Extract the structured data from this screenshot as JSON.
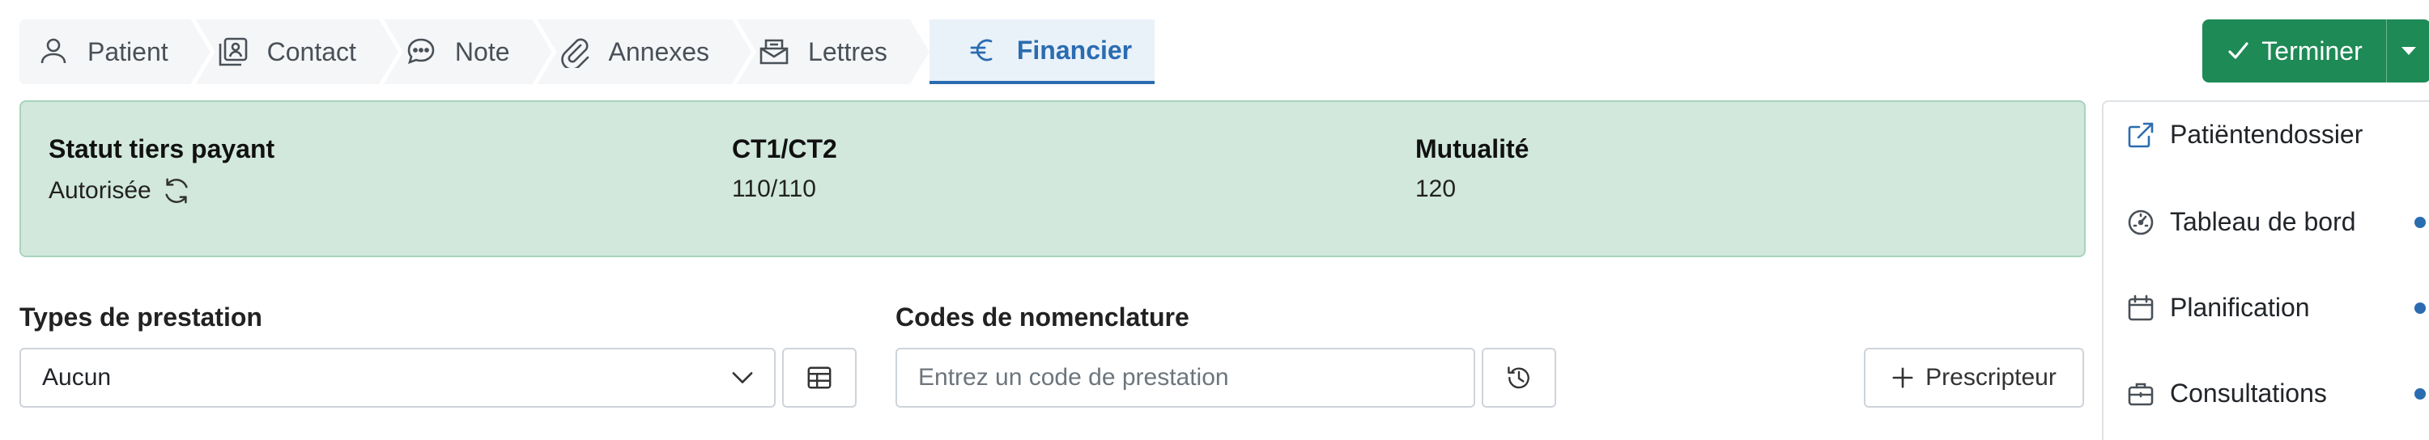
{
  "tabs": [
    {
      "label": "Patient",
      "icon": "person-icon"
    },
    {
      "label": "Contact",
      "icon": "contact-card-icon"
    },
    {
      "label": "Note",
      "icon": "chat-bubble-icon"
    },
    {
      "label": "Annexes",
      "icon": "paperclip-icon"
    },
    {
      "label": "Lettres",
      "icon": "mailbox-icon"
    },
    {
      "label": "Financier",
      "icon": "euro-icon",
      "active": true
    }
  ],
  "actions": {
    "finish_label": "Terminer"
  },
  "status_panel": {
    "third_party_status": {
      "heading": "Statut tiers payant",
      "value": "Autorisée"
    },
    "ct": {
      "heading": "CT1/CT2",
      "value": "110/110"
    },
    "mutuality": {
      "heading": "Mutualité",
      "value": "120"
    }
  },
  "form": {
    "service_types": {
      "label": "Types de prestation",
      "value": "Aucun"
    },
    "nomenclature": {
      "label": "Codes de nomenclature",
      "placeholder": "Entrez un code de prestation"
    },
    "prescriber_label": "Prescripteur"
  },
  "side_menu": [
    {
      "label": "Patiëntendossier",
      "icon": "external-link-icon",
      "indicator": false
    },
    {
      "label": "Tableau de bord",
      "icon": "speedometer-icon",
      "indicator": true
    },
    {
      "label": "Planification",
      "icon": "calendar-icon",
      "indicator": true
    },
    {
      "label": "Consultations",
      "icon": "briefcase-icon",
      "indicator": true
    }
  ],
  "colors": {
    "accent": "#2b6cb0",
    "success": "#1e8a56",
    "status_bg": "#d2e8dd"
  }
}
